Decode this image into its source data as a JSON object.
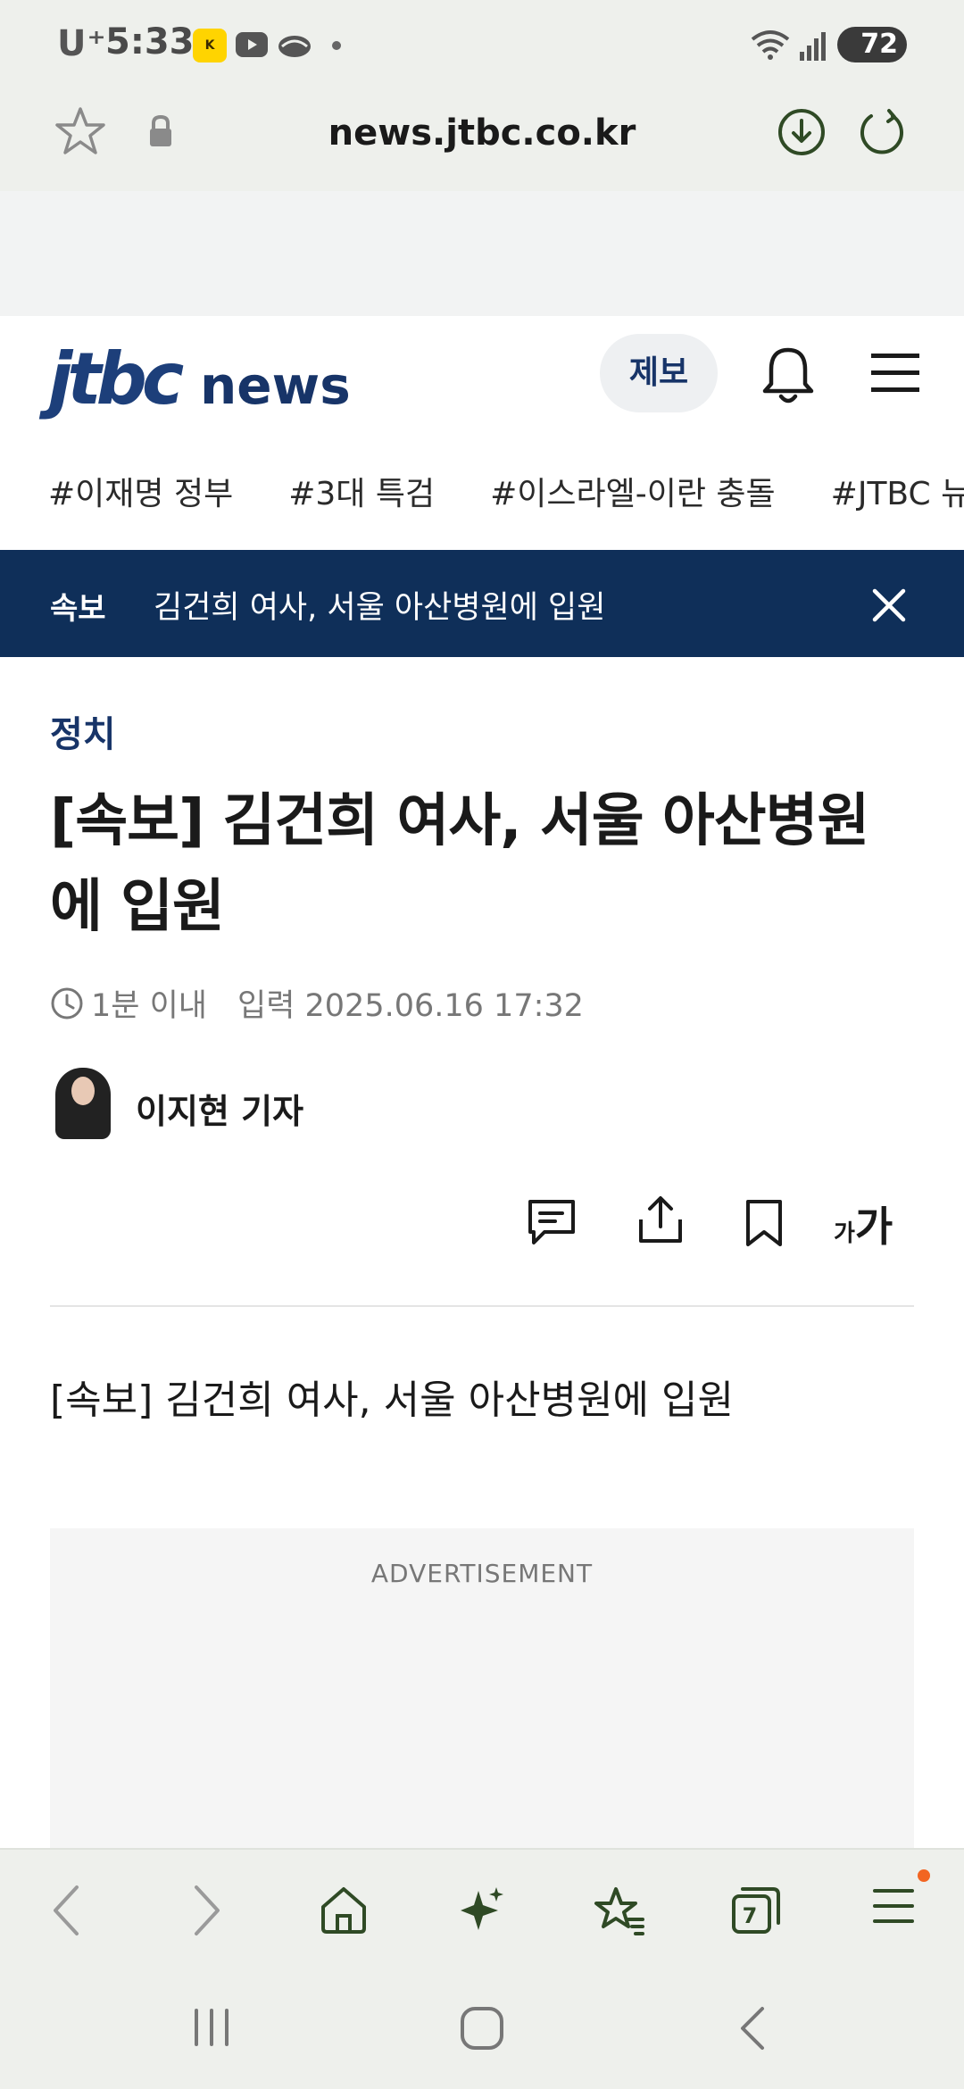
{
  "status_bar": {
    "carrier": "U⁺",
    "time": "5:33",
    "battery": "72"
  },
  "browser": {
    "url": "news.jtbc.co.kr",
    "tabs_count": "7"
  },
  "site": {
    "logo_main": "jtbc",
    "logo_sub": "news",
    "tip_button": "제보",
    "tags": [
      "#이재명 정부",
      "#3대 특검",
      "#이스라엘-이란 충돌",
      "#JTBC 뉴"
    ]
  },
  "breaking": {
    "label": "속보",
    "text": "김건희 여사, 서울 아산병원에 입원"
  },
  "article": {
    "section": "정치",
    "headline": "[속보] 김건희 여사, 서울 아산병원에 입원",
    "read_time": "1분 이내",
    "published": "입력 2025.06.16 17:32",
    "reporter": "이지현 기자",
    "font_small": "가",
    "font_large": "가",
    "body": "[속보] 김건희 여사, 서울 아산병원에 입원",
    "ad_label": "ADVERTISEMENT"
  },
  "colors": {
    "brand_navy": "#0f2f59",
    "browser_green": "#2f4a25",
    "notification": "#f26522"
  }
}
